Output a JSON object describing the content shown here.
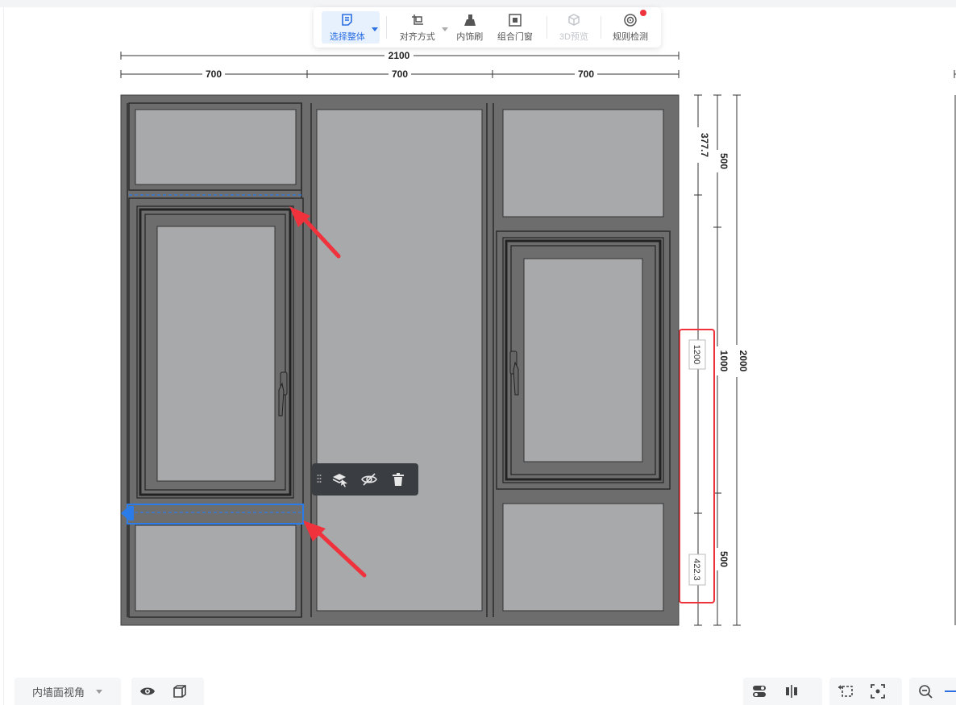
{
  "toolbar": {
    "select_whole": "选择整体",
    "align": "对齐方式",
    "trim_brush": "内饰刷",
    "combine_window": "组合门窗",
    "preview_3d": "3D预览",
    "rule_check": "规则检测"
  },
  "dimensions": {
    "total_width": "2100",
    "segment_widths": [
      "700",
      "700",
      "700"
    ],
    "total_height": "2000",
    "right_outer": [
      "500",
      "1000",
      "500"
    ],
    "right_inner_top": "377.7",
    "right_inner_middle": "1200",
    "right_inner_bottom": "422.3"
  },
  "bottom": {
    "view_select": "内墙面视角"
  },
  "colors": {
    "frame_fill": "#6d6d6d",
    "glass_fill": "#a8a9ab",
    "selection_blue": "#2b7ce9",
    "annotation_red": "#f0323c"
  }
}
